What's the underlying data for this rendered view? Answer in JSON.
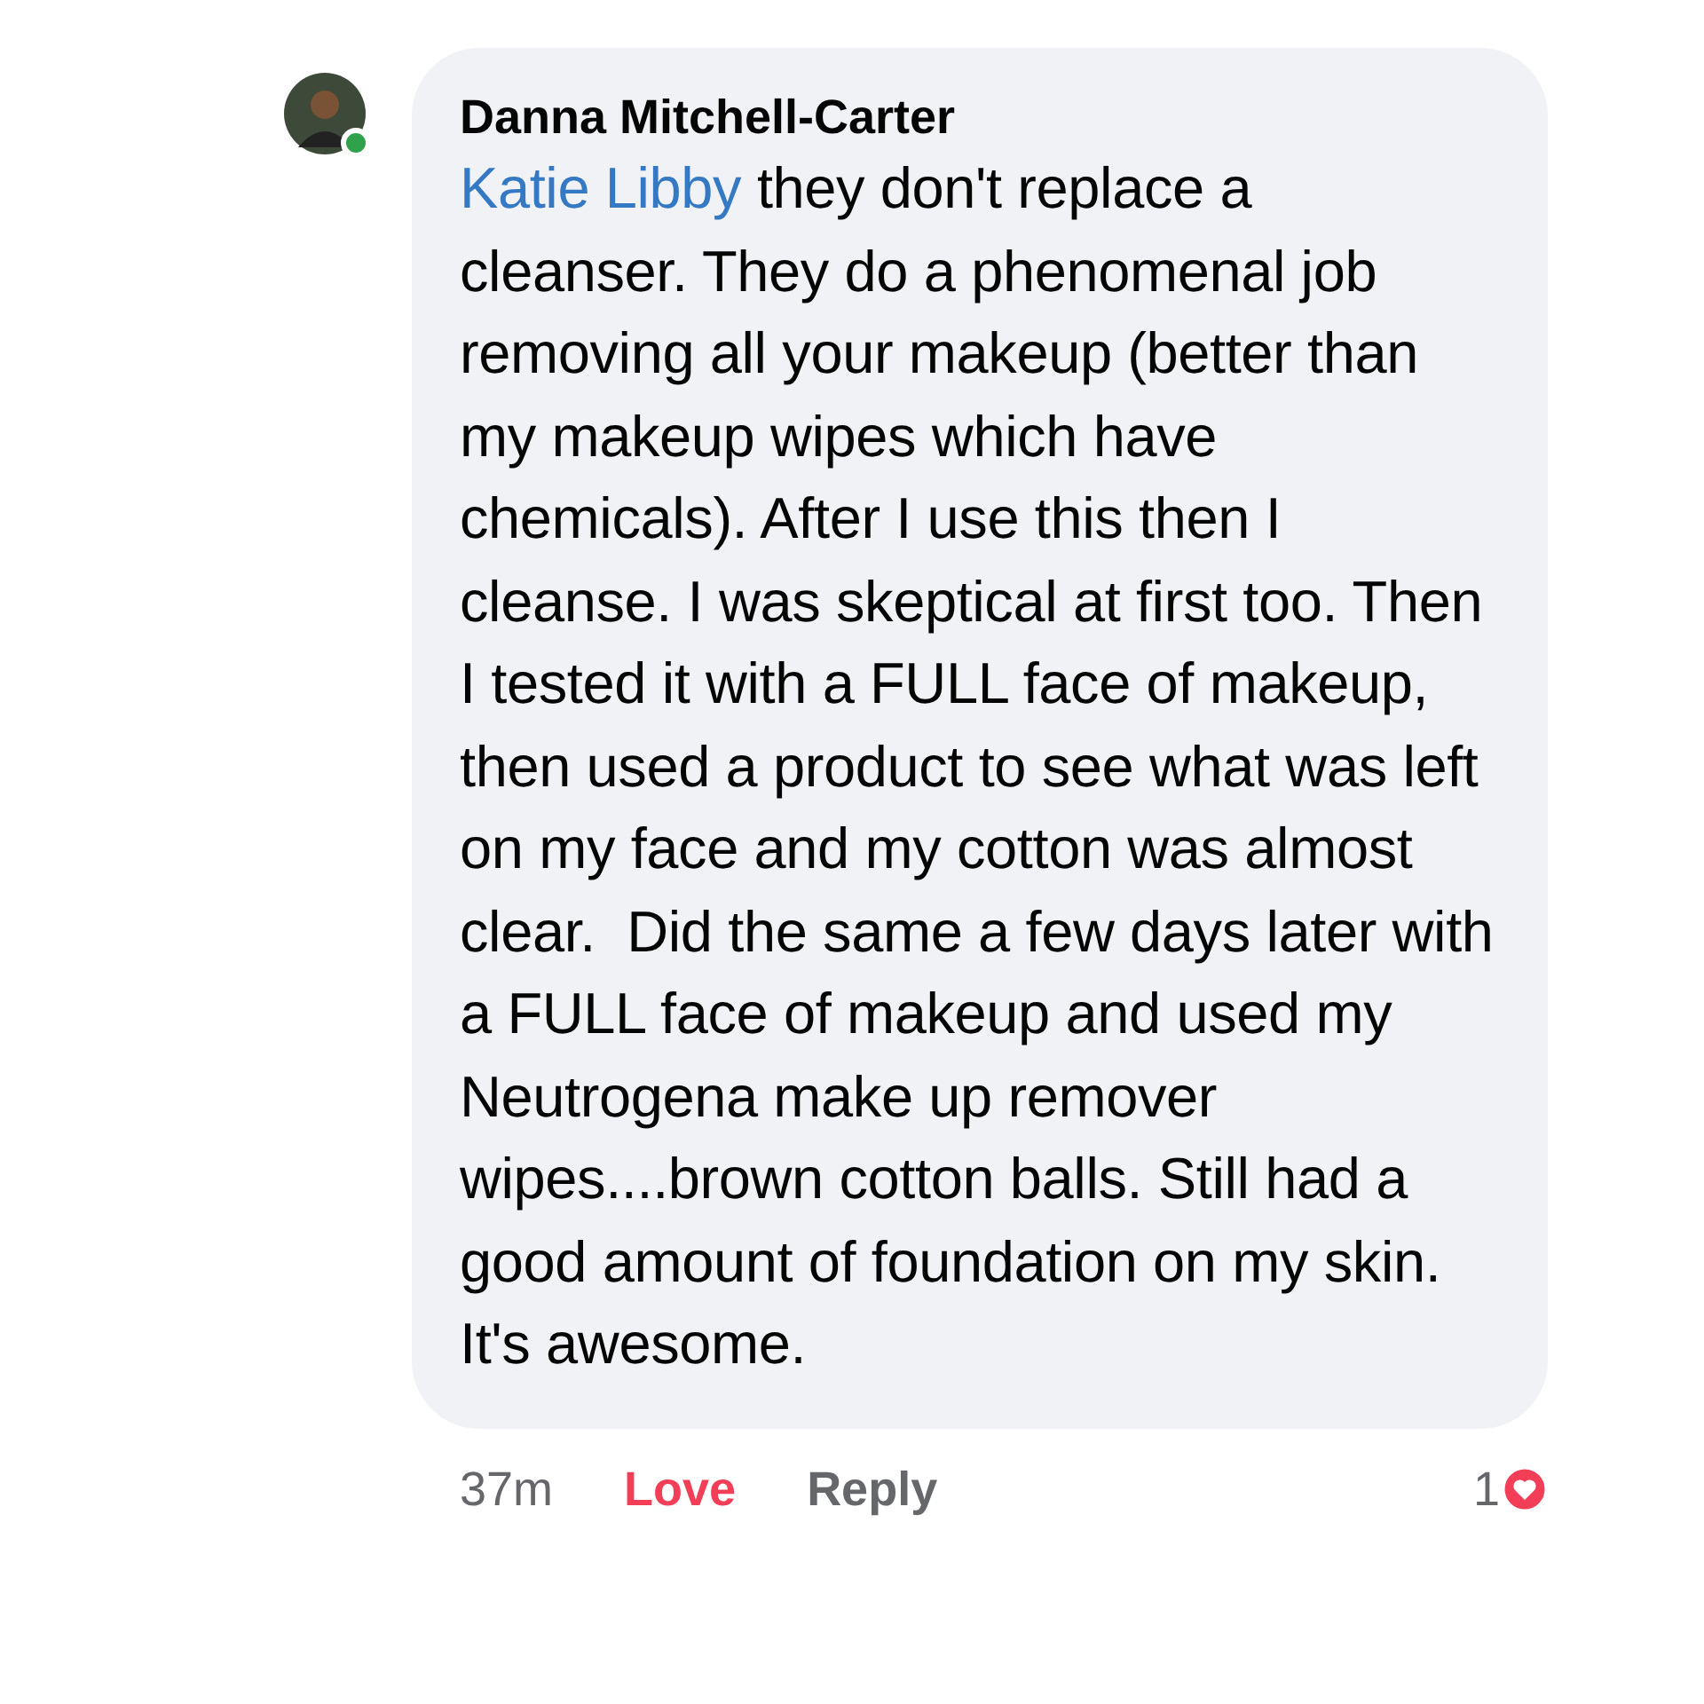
{
  "comment": {
    "author": "Danna Mitchell-Carter",
    "online": true,
    "mention": "Katie Libby",
    "text": " they don't replace a cleanser. They do a phenomenal job removing all your makeup (better than my makeup wipes which have chemicals). After I use this then I cleanse. I was skeptical at first too. Then I tested it with a FULL face of makeup, then used a product to see what was left on my face and my cotton was almost clear.  Did the same a few days later with a FULL face of makeup and used my Neutrogena make up remover wipes....brown cotton balls. Still had a good amount of foundation on my skin. It's awesome.",
    "time": "37m",
    "actions": [
      {
        "label": "Love",
        "selected": true
      },
      {
        "label": "Reply",
        "selected": false
      }
    ],
    "reaction_count": "1"
  }
}
